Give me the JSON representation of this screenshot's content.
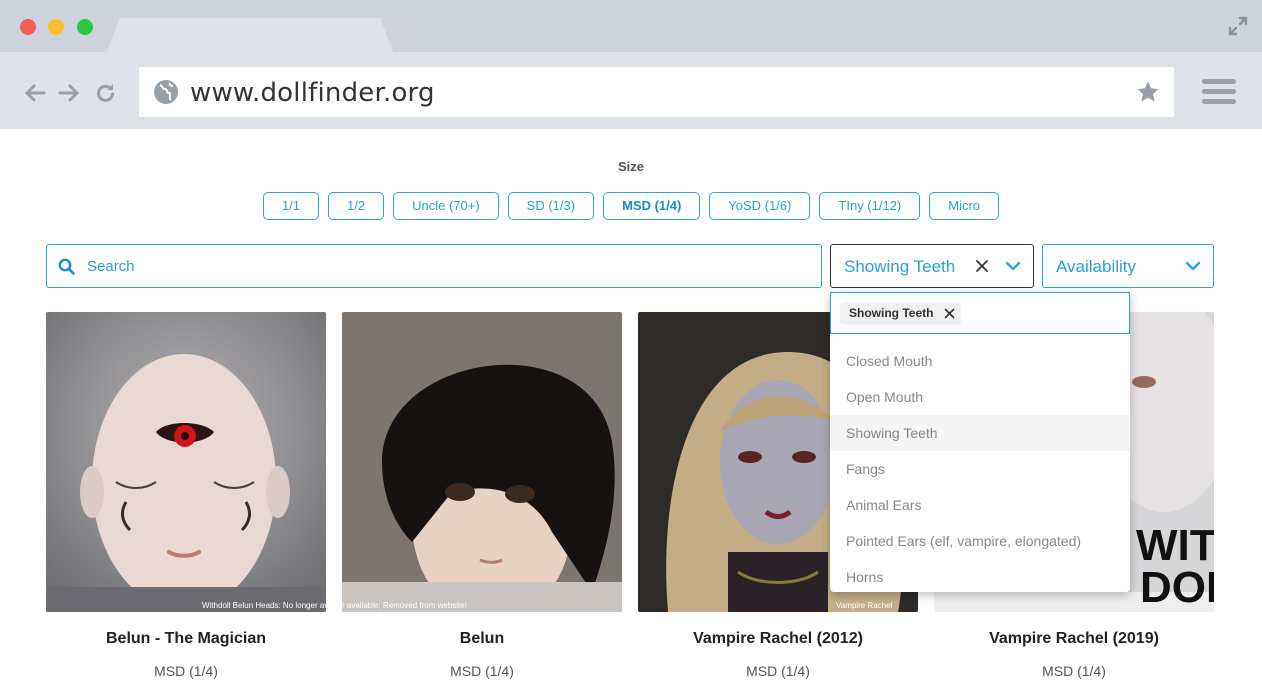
{
  "browser": {
    "url": "www.dollfinder.org"
  },
  "filters": {
    "size_label": "Size",
    "sizes": [
      "1/1",
      "1/2",
      "Uncle (70+)",
      "SD (1/3)",
      "MSD (1/4)",
      "YoSD (1/6)",
      "TIny (1/12)",
      "Micro"
    ],
    "active_size": "MSD (1/4)",
    "search_placeholder": "Search",
    "mouth_select_value": "Showing Teeth",
    "availability_placeholder": "Availability"
  },
  "dropdown": {
    "chip_label": "Showing Teeth",
    "options": [
      "Closed Mouth",
      "Open Mouth",
      "Showing Teeth",
      "Fangs",
      "Animal Ears",
      "Pointed Ears (elf, vampire, elongated)",
      "Horns"
    ],
    "selected": "Showing Teeth"
  },
  "results": [
    {
      "name": "Belun - The Magician",
      "size": "MSD (1/4)",
      "caption": "Withdoll Belun Heads: No longer available; Removed from website!"
    },
    {
      "name": "Belun",
      "size": "MSD (1/4)",
      "caption": ""
    },
    {
      "name": "Vampire Rachel (2012)",
      "size": "MSD (1/4)",
      "caption": "Vampire Rachel"
    },
    {
      "name": "Vampire Rachel (2019)",
      "size": "MSD (1/4)",
      "caption": "WITH DOLL"
    }
  ],
  "colors": {
    "accent": "#2aa4e0",
    "chrome": "#dfe2e8"
  }
}
